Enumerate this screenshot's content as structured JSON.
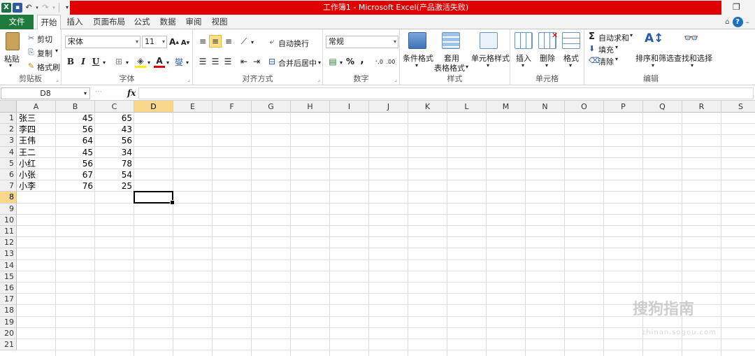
{
  "window": {
    "title": "工作簿1 - Microsoft Excel(产品激活失败)"
  },
  "tabs": {
    "file": "文件",
    "items": [
      "开始",
      "插入",
      "页面布局",
      "公式",
      "数据",
      "审阅",
      "视图"
    ],
    "active": "开始"
  },
  "ribbon": {
    "clipboard": {
      "paste": "粘贴",
      "cut": "剪切",
      "copy": "复制",
      "format_painter": "格式刷",
      "label": "剪贴板"
    },
    "font": {
      "name": "宋体",
      "size": "11",
      "bold": "B",
      "italic": "I",
      "underline": "U",
      "phonetic": "燮",
      "label": "字体"
    },
    "alignment": {
      "wrap": "自动换行",
      "merge": "合并后居中",
      "label": "对齐方式"
    },
    "number": {
      "format": "常规",
      "percent": "%",
      "comma": ",",
      "label": "数字"
    },
    "styles": {
      "conditional": "条件格式",
      "table_format_1": "套用",
      "table_format_2": "表格格式",
      "cell_styles": "单元格样式",
      "label": "样式"
    },
    "cells": {
      "insert": "插入",
      "delete": "删除",
      "format": "格式",
      "label": "单元格"
    },
    "editing": {
      "autosum": "自动求和",
      "fill": "填充",
      "clear": "清除",
      "sort": "排序和筛选",
      "find": "查找和选择",
      "label": "编辑"
    }
  },
  "formula_bar": {
    "name_box": "D8",
    "fx": "fx",
    "value": ""
  },
  "columns": [
    "A",
    "B",
    "C",
    "D",
    "E",
    "F",
    "G",
    "H",
    "I",
    "J",
    "K",
    "L",
    "M",
    "N",
    "O",
    "P",
    "Q",
    "R",
    "S"
  ],
  "rows": [
    "1",
    "2",
    "3",
    "4",
    "5",
    "6",
    "7",
    "8",
    "9",
    "10",
    "11",
    "12",
    "13",
    "14",
    "15",
    "16",
    "17",
    "18",
    "19",
    "20",
    "21"
  ],
  "selected_cell": "D8",
  "data": [
    {
      "name": "张三",
      "b": "45",
      "c": "65"
    },
    {
      "name": "李四",
      "b": "56",
      "c": "43"
    },
    {
      "name": "王伟",
      "b": "64",
      "c": "56"
    },
    {
      "name": "王二",
      "b": "45",
      "c": "34"
    },
    {
      "name": "小红",
      "b": "56",
      "c": "78"
    },
    {
      "name": "小张",
      "b": "67",
      "c": "54"
    },
    {
      "name": "小李",
      "b": "76",
      "c": "25"
    }
  ],
  "watermark": {
    "main": "搜狗指南",
    "sub": "zhinan.sogou.com"
  },
  "colors": {
    "file_tab": "#1f7b3d",
    "title_bar": "#e00000",
    "selection_header": "#f8d78a"
  }
}
